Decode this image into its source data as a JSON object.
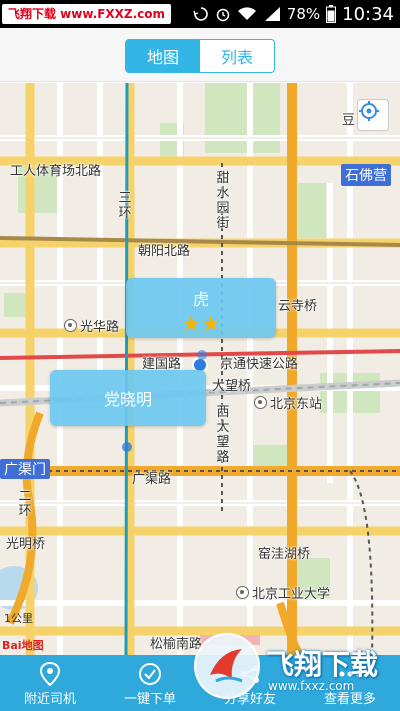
{
  "status_bar": {
    "watermark": "飞翔下载 www.FXXZ.com",
    "battery_percent": "78%",
    "time": "10:34"
  },
  "header": {
    "tabs": [
      {
        "label": "地图",
        "active": true
      },
      {
        "label": "列表",
        "active": false
      }
    ]
  },
  "map": {
    "labels": {
      "gongren": "工人体育场北路",
      "sanhuan": "三环",
      "chaoyang_north": "朝阳北路",
      "tianshui": "甜水园街",
      "guanghua": "光华路",
      "yunsi": "云寺桥",
      "jianguo": "建国路",
      "jingtong": "京通快速公路",
      "dawang_bridge": "大望桥",
      "beijing_east": "北京东站",
      "xidawang": "西大望路",
      "guangqu": "广渠路",
      "erhuan": "二环",
      "guangming": "光明桥",
      "wawa": "窑洼湖桥",
      "bjut": "北京工业大学",
      "songyu": "松榆南路",
      "dou": "豆",
      "shifoying": "石佛营",
      "guangqumen": "广渠门",
      "scale": "1公里",
      "baidu": "Bai地图"
    },
    "markers": [
      {
        "name": "虎",
        "rating": 2
      },
      {
        "name": "党晓明"
      }
    ]
  },
  "tabbar": {
    "items": [
      {
        "label": "附近司机",
        "icon": "location-pin-icon"
      },
      {
        "label": "一键下单",
        "icon": "check-circle-icon"
      },
      {
        "label": "分享好友",
        "icon": "share-icon"
      },
      {
        "label": "查看更多",
        "icon": "more-icon"
      }
    ]
  },
  "watermark_bottom": {
    "title": "飞翔下载",
    "url": "www.fxxz.com"
  },
  "colors": {
    "accent": "#33b5e5",
    "tabbar": "#2fa8dc",
    "bubble": "#6cc8f0"
  }
}
